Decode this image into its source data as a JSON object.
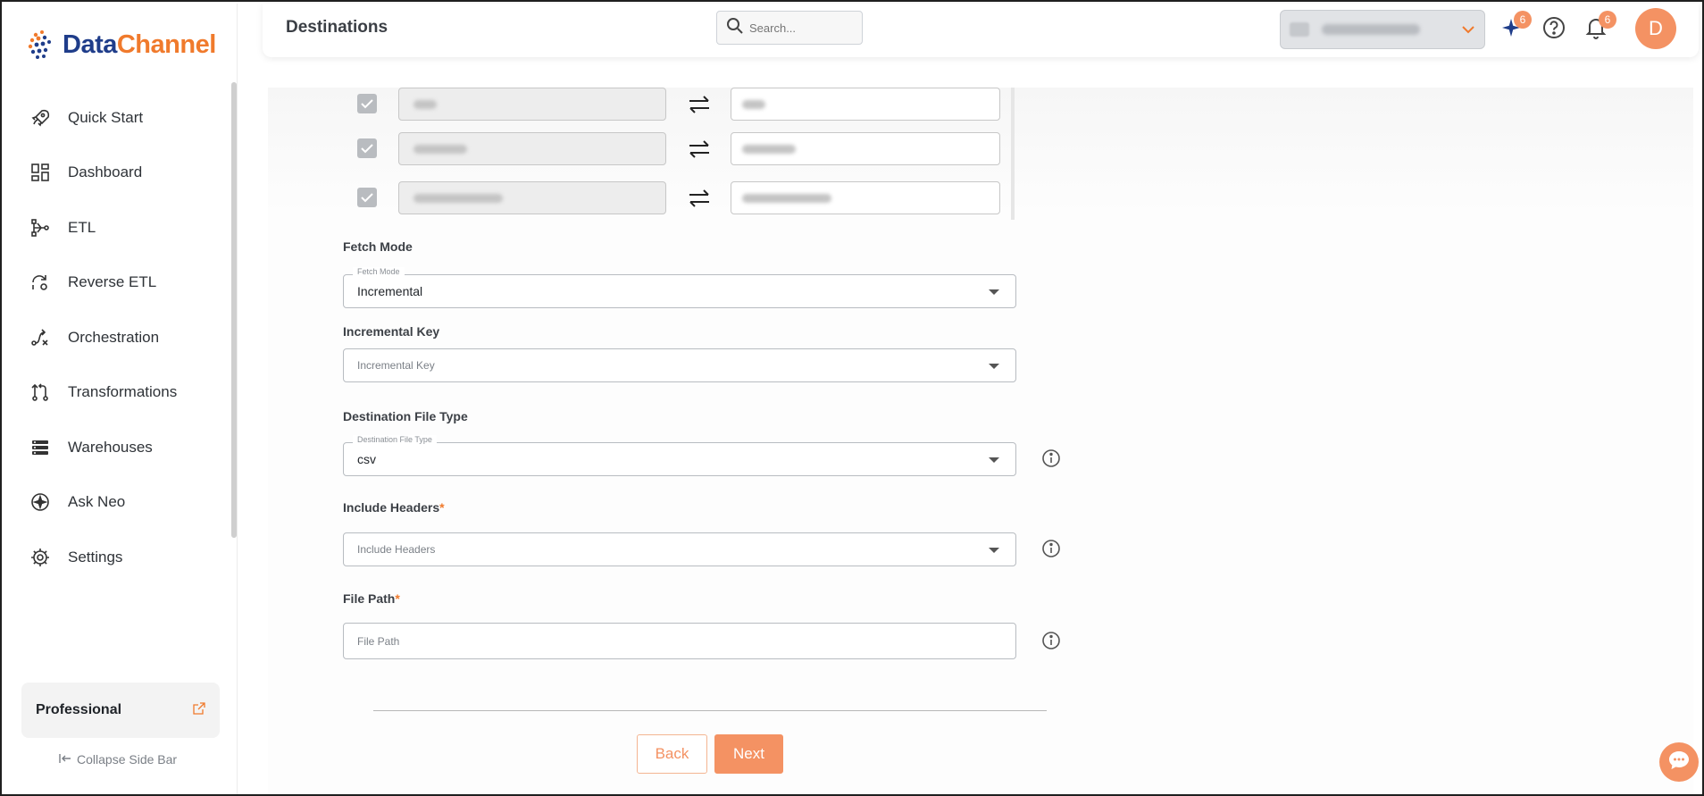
{
  "app": {
    "brand_part1": "Data",
    "brand_part2": "Channel",
    "brand_color_primary": "#1f3d8a",
    "accent_color": "#f49263"
  },
  "sidebar": {
    "items": [
      {
        "label": "Quick Start",
        "icon": "rocket-icon"
      },
      {
        "label": "Dashboard",
        "icon": "dashboard-icon"
      },
      {
        "label": "ETL",
        "icon": "etl-icon"
      },
      {
        "label": "Reverse ETL",
        "icon": "reverse-etl-icon"
      },
      {
        "label": "Orchestration",
        "icon": "orchestration-icon"
      },
      {
        "label": "Transformations",
        "icon": "transformations-icon"
      },
      {
        "label": "Warehouses",
        "icon": "warehouses-icon"
      },
      {
        "label": "Ask Neo",
        "icon": "sparkle-icon"
      },
      {
        "label": "Settings",
        "icon": "gear-icon"
      }
    ],
    "plan": "Professional",
    "collapse_label": "Collapse Side Bar"
  },
  "header": {
    "title": "Destinations",
    "search_placeholder": "Search...",
    "neo_badge": "6",
    "notifications_badge": "6",
    "avatar_initial": "D"
  },
  "form": {
    "fetch_mode": {
      "label": "Fetch Mode",
      "legend": "Fetch Mode",
      "value": "Incremental"
    },
    "incremental_key": {
      "label": "Incremental Key",
      "placeholder": "Incremental Key"
    },
    "destination_file_type": {
      "label": "Destination File Type",
      "legend": "Destination File Type",
      "value": "csv"
    },
    "include_headers": {
      "label": "Include Headers",
      "required_mark": "*",
      "placeholder": "Include Headers"
    },
    "file_path": {
      "label": "File Path",
      "required_mark": "*",
      "placeholder": "File Path"
    }
  },
  "actions": {
    "back_label": "Back",
    "next_label": "Next"
  }
}
